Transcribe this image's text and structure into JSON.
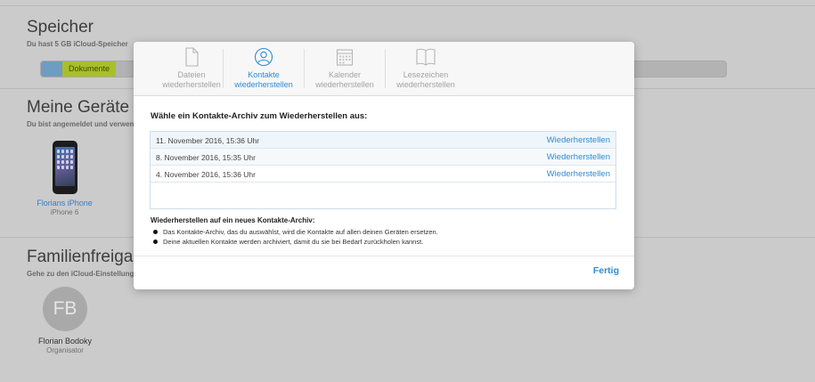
{
  "background": {
    "storage": {
      "title": "Speicher",
      "subtitle": "Du hast 5 GB iCloud-Speicher",
      "segment_label": "Dokumente"
    },
    "devices": {
      "title": "Meine Geräte",
      "subtitle": "Du bist angemeldet und verwendest",
      "items": [
        {
          "name": "Florians iPhone",
          "model": "iPhone 6"
        }
      ]
    },
    "family": {
      "title": "Familienfreigabe",
      "subtitle": "Gehe zu den iCloud-Einstellungen",
      "members": [
        {
          "initials": "FB",
          "name": "Florian Bodoky",
          "role": "Organisator"
        }
      ]
    }
  },
  "modal": {
    "tabs": [
      {
        "label": "Dateien\nwiederherstellen",
        "icon": "file-icon",
        "active": false
      },
      {
        "label": "Kontakte\nwiederherstellen",
        "icon": "contacts-icon",
        "active": true
      },
      {
        "label": "Kalender\nwiederherstellen",
        "icon": "calendar-icon",
        "active": false
      },
      {
        "label": "Lesezeichen\nwiederherstellen",
        "icon": "bookmarks-icon",
        "active": false
      }
    ],
    "prompt": "Wähle ein Kontakte-Archiv zum Wiederherstellen aus:",
    "archives": [
      {
        "date": "11. November 2016, 15:36 Uhr",
        "action": "Wiederherstellen"
      },
      {
        "date": "8. November 2016, 15:35 Uhr",
        "action": "Wiederherstellen"
      },
      {
        "date": "4. November 2016, 15:36 Uhr",
        "action": "Wiederherstellen"
      }
    ],
    "info_title": "Wiederherstellen auf ein neues Kontakte-Archiv:",
    "info_items": [
      "Das Kontakte-Archiv, das du auswählst, wird die Kontakte auf allen deinen Geräten ersetzen.",
      "Deine aktuellen Kontakte werden archiviert, damit du sie bei Bedarf zurückholen kannst."
    ],
    "done_label": "Fertig"
  },
  "colors": {
    "accent": "#2e8bd3",
    "overlay": "#cbcbcb",
    "storage_green": "#a9bf2a",
    "storage_blue": "#6f9cc2"
  }
}
